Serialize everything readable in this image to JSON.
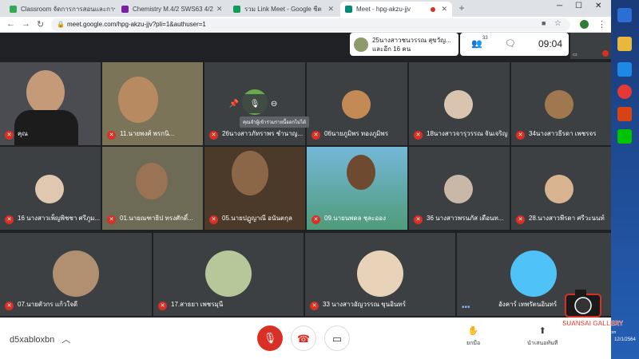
{
  "tabs": [
    {
      "title": "Classroom จัดการการสอนและการเรียนรู้",
      "favicon_color": "#34a853"
    },
    {
      "title": "Chemistry M.4/2 SWS63 4/2",
      "favicon_color": "#7b1fa2"
    },
    {
      "title": "รวม Link Meet - Google ชีต",
      "favicon_color": "#0f9d58"
    },
    {
      "title": "Meet - hpg-akzu-jjv",
      "favicon_color": "#00897b"
    }
  ],
  "url": "meet.google.com/hpg-akzu-jjv?pli=1&authuser=1",
  "notification": {
    "line1": "25นางสาวชนวรรณ สุขวัญ...",
    "line2": "และอีก 16 คน"
  },
  "participant_count": "33",
  "clock": "09:04",
  "tooltip": "คุณจำผู้เข้าร่วมรายนี้ออกไม่ได้",
  "participants": [
    {
      "name": "คุณ"
    },
    {
      "name": "11.นายพงศ์ พรกนิ..."
    },
    {
      "name": "26นางสาวภัทราพร ชำนาญ..."
    },
    {
      "name": "06นายภูมิพร ทองภูมิพร"
    },
    {
      "name": "18นางสาวจารุวรรณ จันเจริญ"
    },
    {
      "name": "34นางสาวธีรดา เพชรจร"
    },
    {
      "name": "16 นางสาวเพ็ญพิชชา ศรีภูม..."
    },
    {
      "name": "01.นายณฑาธิป ทรงศักดิ์..."
    },
    {
      "name": "05.นายปฏูญาณี อนันตกุล"
    },
    {
      "name": "09.นายนพดล ชุละออง"
    },
    {
      "name": "36 นางสาวพรนภัส เดือนท..."
    },
    {
      "name": "28.นางสาวพีรดา ศรีวะนนท์"
    },
    {
      "name": "07.นายตัวกร แก้วใจดี"
    },
    {
      "name": "17.สาธยา เพชรมุนี"
    },
    {
      "name": "33 นางสาวอัญวรรณ ขุนอินทร์"
    },
    {
      "name": "อังคาร์ เทพรัตนอินทร์"
    }
  ],
  "meeting_code": "d5xabloxbn",
  "bottom": {
    "captions": "ยกมือ",
    "present": "นำเสนอทันที"
  },
  "taskbar_date": "12/1/2564",
  "watermark": {
    "title": "SUANSAI GALLERY",
    "sub": "By Saksarat Pattanakorn"
  },
  "colors": {
    "accent_red": "#d93025",
    "meet_bg": "#202124",
    "tile_bg": "#3c4043"
  }
}
